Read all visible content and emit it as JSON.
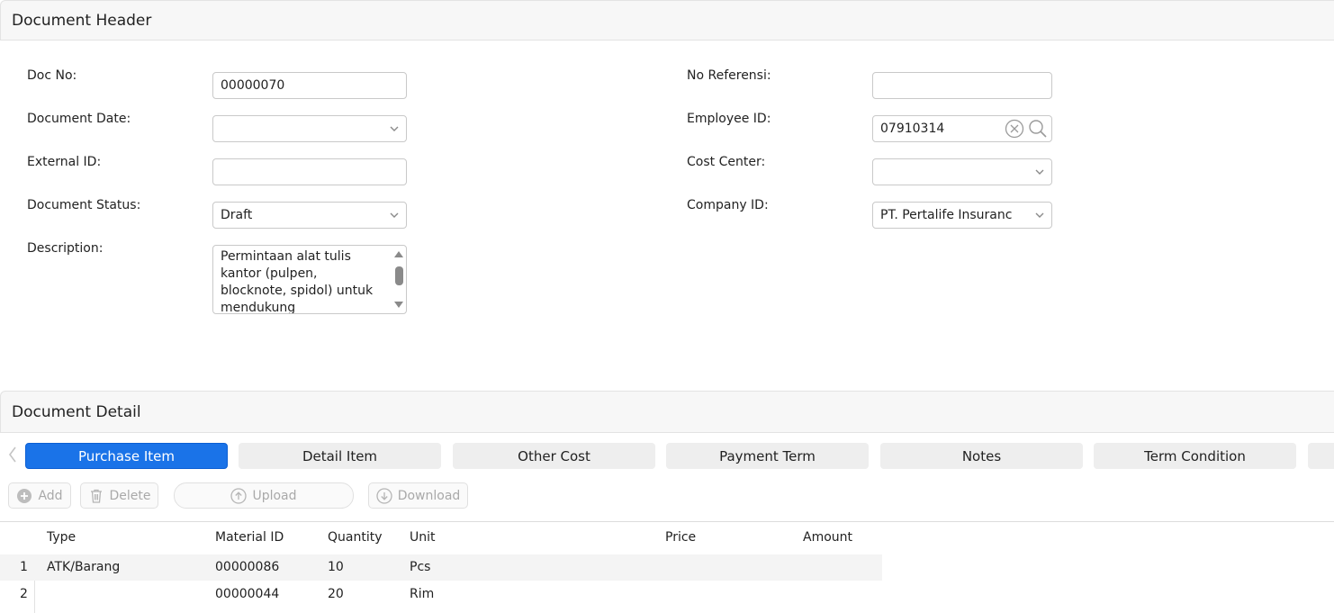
{
  "header_section": {
    "title": "Document Header"
  },
  "form": {
    "doc_no": {
      "label": "Doc No:",
      "value": "00000070"
    },
    "document_date": {
      "label": "Document Date:",
      "value": ""
    },
    "external_id": {
      "label": "External ID:",
      "value": ""
    },
    "document_status": {
      "label": "Document Status:",
      "value": "Draft"
    },
    "description": {
      "label": "Description:",
      "value": "Permintaan alat tulis kantor (pulpen, blocknote, spidol) untuk mendukung"
    },
    "no_referensi": {
      "label": "No Referensi:",
      "value": ""
    },
    "employee_id": {
      "label": "Employee ID:",
      "value": "07910314"
    },
    "cost_center": {
      "label": "Cost Center:",
      "value": ""
    },
    "company_id": {
      "label": "Company ID:",
      "value": "PT. Pertalife Insuranc"
    }
  },
  "detail_section": {
    "title": "Document Detail"
  },
  "tabs": [
    {
      "label": "Purchase Item",
      "active": true
    },
    {
      "label": "Detail Item",
      "active": false
    },
    {
      "label": "Other Cost",
      "active": false
    },
    {
      "label": "Payment Term",
      "active": false
    },
    {
      "label": "Notes",
      "active": false
    },
    {
      "label": "Term Condition",
      "active": false
    }
  ],
  "toolbar": {
    "add": "Add",
    "delete": "Delete",
    "upload": "Upload",
    "download": "Download"
  },
  "table": {
    "columns": {
      "type": "Type",
      "material_id": "Material ID",
      "quantity": "Quantity",
      "unit": "Unit",
      "price": "Price",
      "amount": "Amount"
    },
    "rows": [
      {
        "no": "1",
        "type": "ATK/Barang",
        "material_id": "00000086",
        "quantity": "10",
        "unit": "Pcs",
        "price": "",
        "amount": ""
      },
      {
        "no": "2",
        "type": "",
        "material_id": "00000044",
        "quantity": "20",
        "unit": "Rim",
        "price": "",
        "amount": ""
      }
    ]
  },
  "colors": {
    "accent": "#1a73e8",
    "tab_bg": "#eeeeee",
    "disabled_text": "#a9a9a9"
  }
}
